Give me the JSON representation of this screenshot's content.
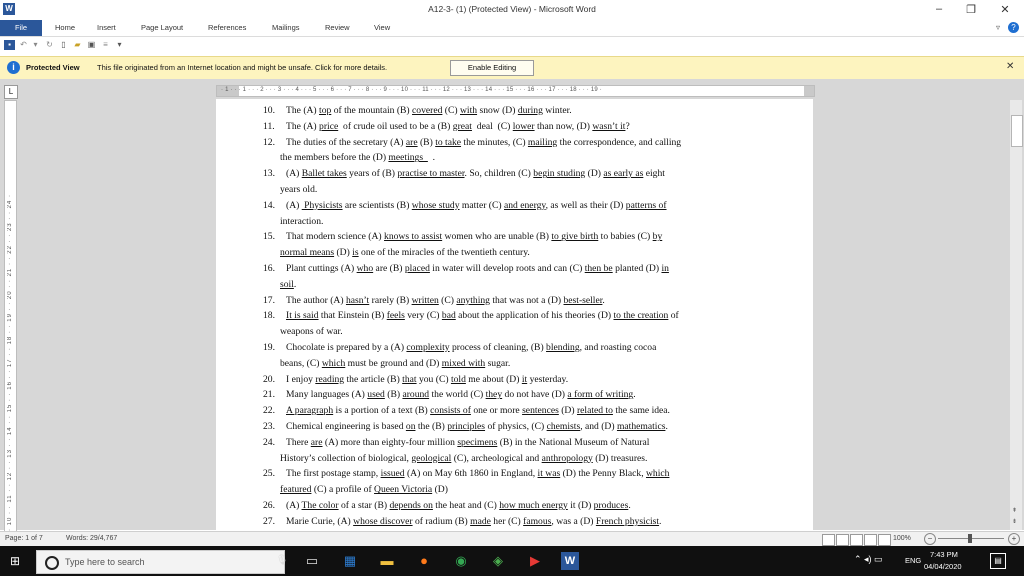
{
  "window": {
    "title": "A12-3- (1) (Protected View) - Microsoft Word",
    "app_icon": "word-icon",
    "minimize": "–",
    "restore": "❐",
    "close": "✕"
  },
  "ribbon": {
    "tabs": [
      {
        "label": "File"
      },
      {
        "label": "Home"
      },
      {
        "label": "Insert"
      },
      {
        "label": "Page Layout"
      },
      {
        "label": "References"
      },
      {
        "label": "Mailings"
      },
      {
        "label": "Review"
      },
      {
        "label": "View"
      }
    ]
  },
  "protected_view": {
    "label": "Protected View",
    "message": "This file originated from an Internet location and might be unsafe. Click for more details.",
    "enable_button": "Enable Editing",
    "close": "✕"
  },
  "ruler": {
    "horizontal": "· 1 · · · 1 · · · 2 · · · 3 · · · 4 · · · 5 · · · 6 · · · 7 · · · 8 · · · 9 · · · 10 · · · 11 · · · 12 · · · 13 · · · 14 · · · 15 · · · 16 · · · 17 · · · 18 · · · 19 ·",
    "vertical": "· 10 · · 11 · · 12 · · 13 · · 14 · · 15 · · 16 · · 17 · · 18 · · 19 · · 20 · · 21 · · 22 · · 23 · · 24 ·"
  },
  "document": {
    "items": [
      {
        "num": "10.",
        "html": "The (A) <u>top</u> of the mountain (B) <u>covered</u> (C) <u>with</u> snow (D) <u>during</u> winter."
      },
      {
        "num": "11.",
        "html": "The (A) <u>price</u>&nbsp; of crude oil used to be a (B) <u>great</u>&nbsp; deal&nbsp; (C) <u>lower</u> than now, (D) <u>wasn’t it</u>?"
      },
      {
        "num": "12.",
        "html": "The duties of the secretary (A) <u>are</u> (B) <u>to take</u> the minutes, (C) <u>mailing</u> the correspondence, and calling",
        "cont": "the members before the (D) <u>meetings&nbsp;&nbsp;</u>&nbsp; ."
      },
      {
        "num": "13.",
        "html": "(A) <u>Ballet takes</u> years of (B) <u>practise to master</u>. So, children (C) <u>begin studing</u> (D) <u>as early as</u> eight",
        "cont": "years old."
      },
      {
        "num": "14.",
        "html": "(A) <u>&nbsp;Physicists</u> are scientists (B) <u>whose study</u> matter (C) <u>and energy</u>, as well as their (D) <u>patterns of</u>",
        "cont": "interaction."
      },
      {
        "num": "15.",
        "html": "That modern science (A) <u>knows to assist</u> women who are unable (B) <u>to give birth</u> to babies (C) <u>by</u>",
        "cont": "<u>normal means</u> (D) <u>is</u> one of the miracles of the twentieth century."
      },
      {
        "num": "16.",
        "html": "Plant cuttings (A) <u>who</u> are (B) <u>placed</u> in water will develop roots and can (C) <u>then be</u> planted (D) <u>in</u>",
        "cont": "<u>soil</u>."
      },
      {
        "num": "17.",
        "html": "The author (A) <u>hasn’t</u> rarely (B) <u>written</u> (C) <u>anything</u> that was not a (D) <u>best-seller</u>."
      },
      {
        "num": "18.",
        "html": "<u>It is said</u> that Einstein (B) <u>feels</u> very (C) <u>bad</u> about the application of his theories (D) <u>to the creation</u> of",
        "cont": "weapons of war."
      },
      {
        "num": "19.",
        "html": "Chocolate is prepared by a (A) <u>complexity</u> process of cleaning, (B) <u>blending</u>, and roasting cocoa",
        "cont": "beans, (C) <u>which</u> must be ground and (D) <u>mixed with</u> sugar."
      },
      {
        "num": "20.",
        "html": "I enjoy <u>reading</u> the article (B) <u>that</u> you (C) <u>told</u> me about (D) <u>it</u> yesterday."
      },
      {
        "num": "21.",
        "html": "Many languages (A) <u>used</u> (B) <u>around</u> the world (C) <u>they</u> do not have (D) <u>a form of writing</u>."
      },
      {
        "num": "22.",
        "html": "<u>A paragraph</u> is a portion of a text (B) <u>consists of</u> one or more <u>sentences</u> (D) <u>related to</u> the same idea."
      },
      {
        "num": "23.",
        "html": "Chemical engineering is based <u>on</u> the (B) <u>principles</u> of physics, (C) <u>chemists</u>, and (D) <u>mathematics</u>."
      },
      {
        "num": "24.",
        "html": "There <u>are</u> (A) more than eighty-four million <u>specimens</u> (B) in the National Museum of Natural",
        "cont": "History’s collection of biological, <u>geological</u> (C), archeological and <u>anthropology</u> (D) treasures."
      },
      {
        "num": "25.",
        "html": "The first postage stamp, <u>issued</u> (A) on May 6th 1860 in England, <u>it was</u> (D) the Penny Black, <u>which</u>",
        "cont": "<u>featured</u> (C) a profile of <u>Queen Victoria</u> (D)"
      },
      {
        "num": "26.",
        "html": "(A) <u>The color</u> of a star (B) <u>depends on</u> the heat and (C) <u>how much energy</u> it (D) <u>produces</u>."
      },
      {
        "num": "27.",
        "html": "Marie Curie, (A) <u>whose discover</u> of radium (B) <u>made</u> her (C) <u>famous</u>, was a (D) <u>French physicist</u>."
      }
    ]
  },
  "status": {
    "page": "Page: 1 of 7",
    "words": "Words: 29/4,767",
    "zoom": "100%"
  },
  "taskbar": {
    "search_placeholder": "Type here to search",
    "time": "7:43 PM",
    "date": "04/04/2020",
    "language": "ENG"
  }
}
